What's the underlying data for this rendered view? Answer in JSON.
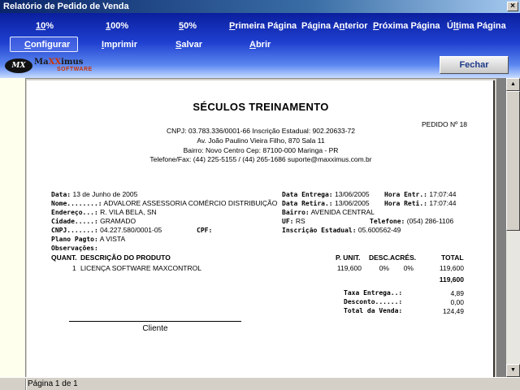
{
  "window": {
    "title": "Relatório de Pedido de Venda",
    "close_glyph": "×"
  },
  "toolbar": {
    "zoom10": {
      "u": "10",
      "rest": "%"
    },
    "zoom100": {
      "u": "1",
      "rest": "00%"
    },
    "zoom50": {
      "u": "5",
      "rest": "0%"
    },
    "first": {
      "u": "P",
      "rest": "rimeira Página"
    },
    "prev": {
      "pre": "Página A",
      "u": "n",
      "rest": "terior"
    },
    "next": {
      "u": "P",
      "rest": "róxima Página"
    },
    "last": {
      "pre": "Ú",
      "u": "lt",
      "rest": "ima Página"
    },
    "configure": {
      "u": "C",
      "rest": "onfigurar"
    },
    "print": {
      "u": "I",
      "rest": "mprimir"
    },
    "save": {
      "u": "S",
      "rest": "alvar"
    },
    "open": {
      "u": "A",
      "rest": "brir"
    },
    "close_label": "Fechar"
  },
  "logo": {
    "mark": "MX",
    "name_prefix": "Ma",
    "name_xx": "XX",
    "name_suffix": "imus",
    "software": "SOFTWARE"
  },
  "report": {
    "company": "SÉCULOS TREINAMENTO",
    "order_label": "PEDIDO Nº",
    "order_number": "18",
    "cnpj_line": "CNPJ: 03.783.336/0001-66 Inscrição Estadual: 902.20633-72",
    "address_line": "Av. João Paulino Vieira Filho, 870 Sala 11",
    "district_line": "Bairro: Novo Centro Cep: 87100-000 Maringa - PR",
    "contact_line": "Telefone/Fax: (44) 225-5155 / (44) 265-1686 suporte@maxximus.com.br",
    "left_fields": [
      {
        "label": "Data:",
        "value": "13 de Junho de 2005"
      },
      {
        "label": "Nome........:",
        "value": "ADVALORE ASSESSORIA COMÉRCIO DISTRIBUIÇÃO"
      },
      {
        "label": "Endereço...:",
        "value": "R. VILA BELA, SN"
      },
      {
        "label": "Cidade.....:",
        "value": "GRAMADO"
      },
      {
        "label": "CNPJ.......:",
        "value": "04.227.580/0001-05"
      },
      {
        "label": "Plano Pagto:",
        "value": "A VISTA"
      },
      {
        "label": "Observações:",
        "value": ""
      }
    ],
    "cpf_label": "CPF:",
    "right_fields": {
      "entrega_label": "Data Entrega:",
      "entrega_value": "13/06/2005",
      "hora_entr_label": "Hora Entr.:",
      "hora_entr_value": "17:07:44",
      "retira_label": "Data Retira.:",
      "retira_value": "13/06/2005",
      "hora_reti_label": "Hora Reti.:",
      "hora_reti_value": "17:07:44",
      "bairro_label": "Bairro:",
      "bairro_value": "AVENIDA CENTRAL",
      "uf_label": "UF:",
      "uf_value": "RS",
      "telefone_label": "Telefone:",
      "telefone_value": "(054) 286-1106",
      "ie_label": "Inscrição Estadual:",
      "ie_value": "05.600562-49"
    },
    "columns": {
      "quant": "QUANT.",
      "desc": "DESCRIÇÃO DO PRODUTO",
      "unit": "P. UNIT.",
      "discount": "DESC.",
      "surcharge": "ACRÉS.",
      "total": "TOTAL"
    },
    "items": [
      {
        "qty": "1",
        "desc": "LICENÇA SOFTWARE MAXCONTROL",
        "unit": "119,600",
        "discount": "0%",
        "surcharge": "0%",
        "total": "119,600"
      }
    ],
    "subtotal": "119,600",
    "totals": [
      {
        "label": "Taxa Entrega..:",
        "value": "4,89"
      },
      {
        "label": "Desconto......:",
        "value": "0,00"
      },
      {
        "label": "Total da Venda:",
        "value": "124,49"
      }
    ],
    "signature_label": "Cliente"
  },
  "status": {
    "page_text": "Página 1 de 1"
  }
}
